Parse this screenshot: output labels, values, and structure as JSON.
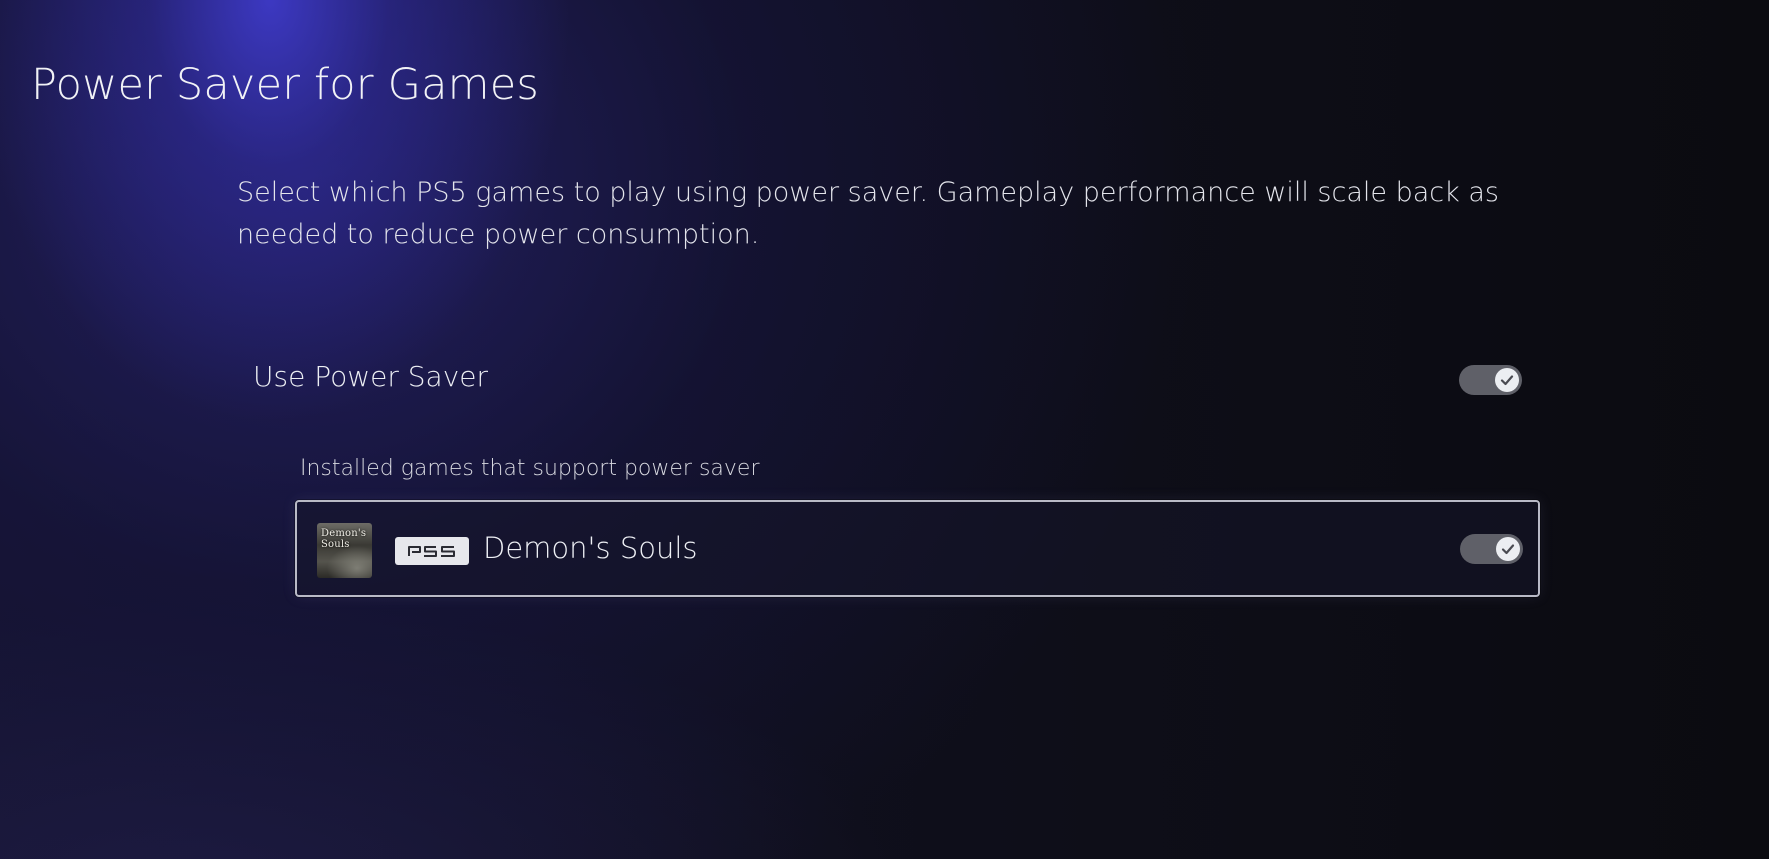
{
  "header": {
    "title": "Power Saver for Games"
  },
  "description": "Select which PS5 games to play using power saver. Gameplay performance will scale back as needed to reduce power consumption.",
  "use_power_saver": {
    "label": "Use Power Saver",
    "enabled": true
  },
  "games_section": {
    "label": "Installed games that support power saver",
    "games": [
      {
        "title": "Demon's Souls",
        "platform_badge": "PS5",
        "thumbnail_text": "Demon's Souls",
        "enabled": true
      }
    ]
  },
  "colors": {
    "background": "#0d0d14",
    "glow": "#3e3ac8",
    "toggle_track": "#5f6068",
    "toggle_knob": "#eceef2",
    "focus_border": "#b9bac6"
  },
  "icons": {
    "toggle_check": "checkmark-icon",
    "platform": "ps5-logo-icon"
  }
}
